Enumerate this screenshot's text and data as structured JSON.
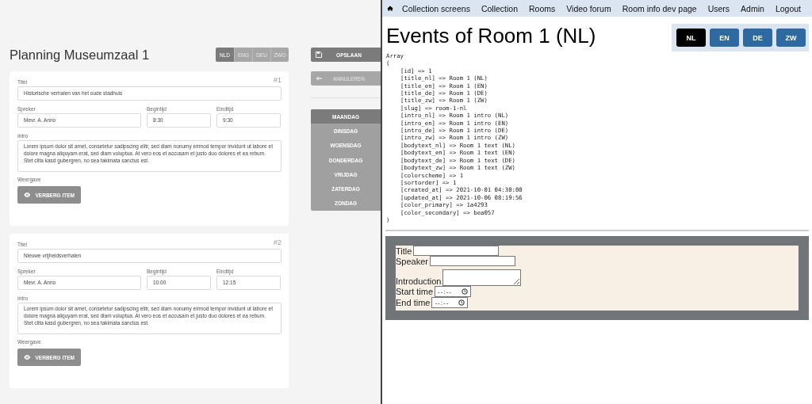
{
  "editor": {
    "title": "Planning Museumzaal 1",
    "languages": [
      {
        "label": "NLD",
        "selected": true
      },
      {
        "label": "ENG",
        "selected": false
      },
      {
        "label": "DEU",
        "selected": false
      },
      {
        "label": "ZWO",
        "selected": false
      }
    ],
    "events": [
      {
        "number": "#1",
        "title_label": "Titel",
        "title": "Historische verhalen van het oude stadhuis",
        "speaker_label": "Spreker",
        "speaker": "Mevr. A. Anno",
        "start_label": "Begintijd",
        "start": "8:30",
        "end_label": "Eindtijd",
        "end": "9:30",
        "intro_label": "Intro",
        "intro": "Lorem ipsum dolor sit amet, consetetur sadipscing elitr, sed diam nonumy eirmod tempor invidunt ut labore et dolore magna aliquyam erat, sed diam voluptua. At vero eos et accusam et justo duo dolores et ea rebum. Stet clita kasd gubergren, no sea takimata sanctus est.",
        "display_label": "Weergave",
        "hide_button": "VERBERG ITEM"
      },
      {
        "number": "#2",
        "title_label": "Titel",
        "title": "Nieuwe vrijheidsverhalen",
        "speaker_label": "Spreker",
        "speaker": "Mevr. A. Anno",
        "start_label": "Begintijd",
        "start": "10:00",
        "end_label": "Eindtijd",
        "end": "12:15",
        "intro_label": "Intro",
        "intro": "Lorem ipsum dolor sit amet, consetetur sadipscing elitr, sed diam nonumy eirmod tempor invidunt ut labore et dolore magna aliquyam erat, sed diam voluptua. At vero eos et accusam et justo duo dolores et ea rebum. Stet clita kasd gubergren, no sea takimata sanctus est.",
        "display_label": "Weergave",
        "hide_button": "VERBERG ITEM"
      }
    ],
    "actions": [
      {
        "kind": "save",
        "label": "OPSLAAN"
      },
      {
        "kind": "cancel",
        "label": "ANNULEREN"
      }
    ],
    "days": [
      {
        "label": "MAANDAG",
        "selected": true
      },
      {
        "label": "DINSDAG",
        "selected": false
      },
      {
        "label": "WOENSDAG",
        "selected": false
      },
      {
        "label": "DONDERDAG",
        "selected": false
      },
      {
        "label": "VRIJDAG",
        "selected": false
      },
      {
        "label": "ZATERDAG",
        "selected": false
      },
      {
        "label": "ZONDAG",
        "selected": false
      }
    ]
  },
  "page": {
    "nav": [
      "Collection screens",
      "Collection",
      "Rooms",
      "Video forum",
      "Room info dev page",
      "Users",
      "Admin",
      "Logout"
    ],
    "heading": "Events of Room 1 (NL)",
    "languages": [
      {
        "label": "NL",
        "selected": true
      },
      {
        "label": "EN",
        "selected": false
      },
      {
        "label": "DE",
        "selected": false
      },
      {
        "label": "ZW",
        "selected": false
      }
    ],
    "dump": {
      "header": "Array",
      "open": "(",
      "close": ")",
      "entries": [
        "[id] => 1",
        "[title_nl] => Room 1 (NL)",
        "[title_en] => Room 1 (EN)",
        "[title_de] => Room 1 (DE)",
        "[title_zw] => Room 1 (ZW)",
        "[slug] => room-1-nl",
        "[intro_nl] => Room 1 intro (NL)",
        "[intro_en] => Room 1 intro (EN)",
        "[intro_de] => Room 1 intro (DE)",
        "[intro_zw] => Room 1 intro (ZW)",
        "[bodytext_nl] => Room 1 text (NL)",
        "[bodytext_en] => Room 1 text (EN)",
        "[bodytext_de] => Room 1 text (DE)",
        "[bodytext_zw] => Room 1 text (ZW)",
        "[colorscheme] => 1",
        "[sortorder] => 1",
        "[created_at] => 2021-10-01 04:30:00",
        "[updated_at] => 2021-10-06 08:19:56",
        "[color_primary] => 1a4293",
        "[color_secondary] => bea057"
      ]
    },
    "form": [
      {
        "kind": "text",
        "label": "Title"
      },
      {
        "kind": "text",
        "label": "Speaker"
      },
      {
        "kind": "textarea",
        "label": "Introduction"
      },
      {
        "kind": "time",
        "label": "Start time",
        "placeholder": "--:--"
      },
      {
        "kind": "time",
        "label": "End time",
        "placeholder": "--:--"
      }
    ]
  }
}
